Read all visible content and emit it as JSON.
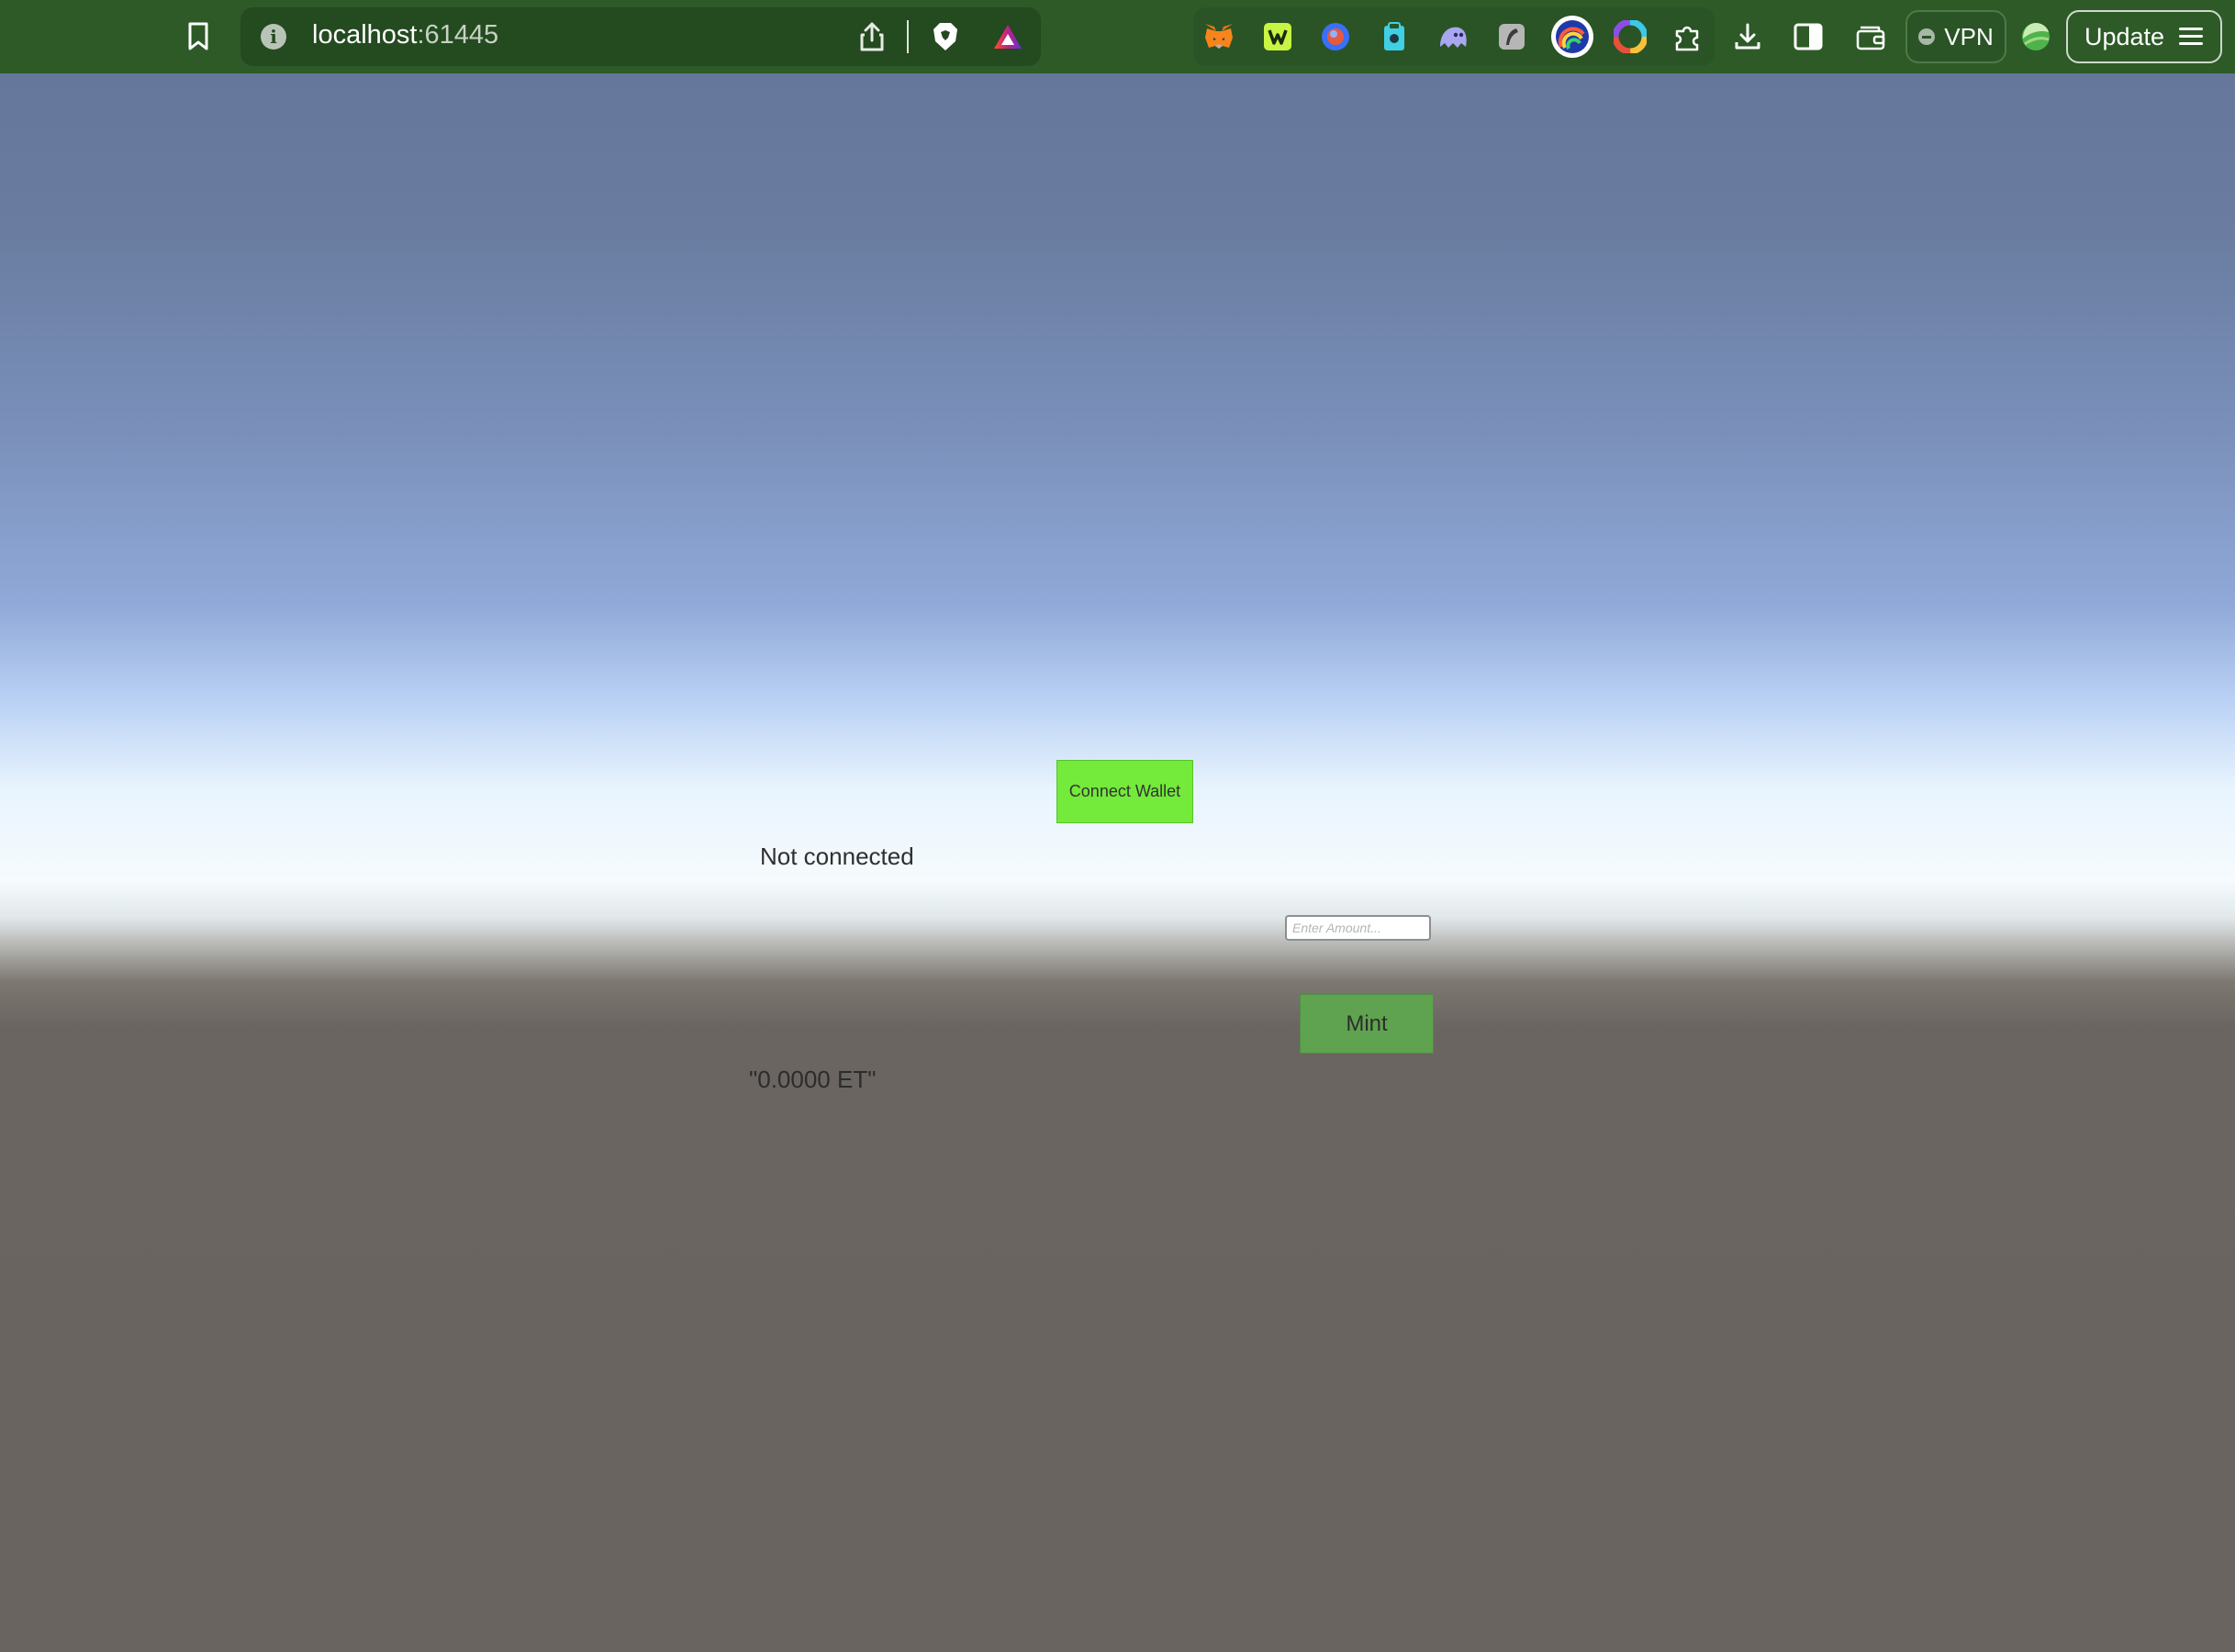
{
  "browser": {
    "url": {
      "host": "localhost",
      "port": ":61445"
    },
    "toolbar_icons": [
      "bookmark-icon",
      "site-info-icon",
      "share-icon",
      "brave-shields-icon",
      "brave-rewards-icon"
    ],
    "extensions": [
      "metamask-icon",
      "extension-green-icon",
      "extension-blue-orb-icon",
      "extension-clipboard-icon",
      "extension-ghost-icon",
      "extension-gray-icon",
      "extension-rainbow-icon",
      "extension-color-wheel-icon",
      "extensions-puzzle-icon",
      "downloads-icon",
      "sidebar-icon",
      "wallet-icon"
    ],
    "vpn_label": "VPN",
    "update_label": "Update",
    "colors": {
      "toolbar": "#2d5a27",
      "urlbar": "#244a20"
    }
  },
  "app": {
    "connect_button_label": "Connect Wallet",
    "status": "Not connected",
    "amount_placeholder": "Enter Amount...",
    "amount_value": "",
    "mint_button_label": "Mint",
    "balance": "\"0.0000 ET\"",
    "colors": {
      "connect_button": "#74ea3a",
      "mint_button": "#5fa350",
      "ground": "#696460"
    }
  }
}
